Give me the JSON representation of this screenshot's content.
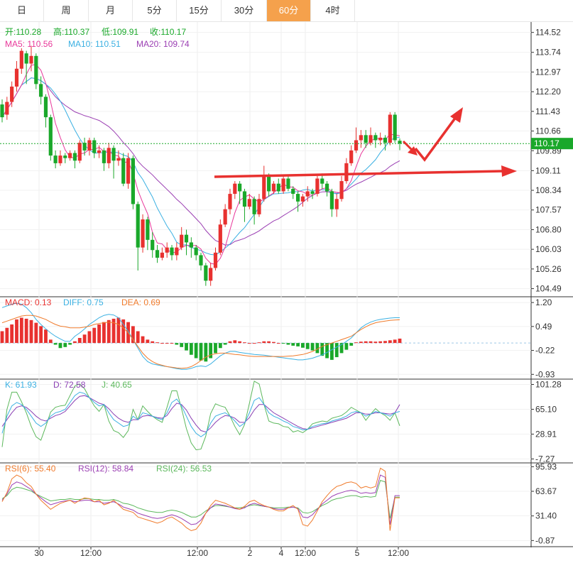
{
  "tabs": [
    {
      "label": "日",
      "active": false
    },
    {
      "label": "周",
      "active": false
    },
    {
      "label": "月",
      "active": false
    },
    {
      "label": "5分",
      "active": false
    },
    {
      "label": "15分",
      "active": false
    },
    {
      "label": "30分",
      "active": false
    },
    {
      "label": "60分",
      "active": true
    },
    {
      "label": "4时",
      "active": false
    }
  ],
  "colors": {
    "up": "#e8312f",
    "down": "#1aa82a",
    "ma5": "#e8389a",
    "ma10": "#3ab0e2",
    "ma20": "#9b3fb3",
    "macd": "#e8312f",
    "diff": "#3ab0e2",
    "dea": "#f07b2c",
    "k": "#3ab0e2",
    "d": "#8a3fb3",
    "j": "#5cb85c",
    "rsi6": "#f07b2c",
    "rsi12": "#9b3fb3",
    "rsi24": "#5cb85c",
    "active_tab": "#f5a14c",
    "price_tag": "#1aa82a",
    "arrow": "#e8312f"
  },
  "legend": {
    "ohlc": [
      {
        "label": "开:",
        "value": "110.28",
        "color": "#1aa82a"
      },
      {
        "label": "高:",
        "value": "110.37",
        "color": "#1aa82a"
      },
      {
        "label": "低:",
        "value": "109.91",
        "color": "#1aa82a"
      },
      {
        "label": "收:",
        "value": "110.17",
        "color": "#1aa82a"
      }
    ],
    "ma": [
      {
        "label": "MA5: ",
        "value": "110.56",
        "color": "#e8389a"
      },
      {
        "label": "MA10: ",
        "value": "110.51",
        "color": "#3ab0e2"
      },
      {
        "label": "MA20: ",
        "value": "109.74",
        "color": "#9b3fb3"
      }
    ],
    "macd": [
      {
        "label": "MACD: ",
        "value": "0.13",
        "color": "#e8312f"
      },
      {
        "label": "DIFF: ",
        "value": "0.75",
        "color": "#3ab0e2"
      },
      {
        "label": "DEA: ",
        "value": "0.69",
        "color": "#f07b2c"
      }
    ],
    "kdj": [
      {
        "label": "K: ",
        "value": "61.93",
        "color": "#3ab0e2"
      },
      {
        "label": "D: ",
        "value": "72.58",
        "color": "#8a3fb3"
      },
      {
        "label": "J: ",
        "value": "40.65",
        "color": "#5cb85c"
      }
    ],
    "rsi": [
      {
        "label": "RSI(6): ",
        "value": "55.40",
        "color": "#f07b2c"
      },
      {
        "label": "RSI(12): ",
        "value": "58.84",
        "color": "#9b3fb3"
      },
      {
        "label": "RSI(24): ",
        "value": "56.53",
        "color": "#5cb85c"
      }
    ]
  },
  "price_axis": {
    "ticks": [
      "114.52",
      "113.74",
      "112.97",
      "112.20",
      "111.43",
      "110.66",
      "109.89",
      "109.11",
      "108.34",
      "107.57",
      "106.80",
      "106.03",
      "105.26",
      "104.49"
    ],
    "current": "110.17"
  },
  "macd_axis": {
    "ticks": [
      "1.20",
      "0.49",
      "-0.22",
      "-0.93"
    ]
  },
  "kdj_axis": {
    "ticks": [
      "101.28",
      "65.10",
      "28.91",
      "-7.27"
    ]
  },
  "rsi_axis": {
    "ticks": [
      "95.93",
      "63.67",
      "31.40",
      "-0.87"
    ]
  },
  "time_axis": {
    "labels": [
      "30",
      "12:00",
      "12:00",
      "2",
      "4",
      "12:00",
      "5",
      "12:00"
    ]
  },
  "chart_data": {
    "type": "candlestick",
    "candles": [
      {
        "o": 111.7,
        "c": 111.2,
        "h": 111.9,
        "l": 111.0
      },
      {
        "o": 111.3,
        "c": 111.8,
        "h": 112.0,
        "l": 111.1
      },
      {
        "o": 111.8,
        "c": 112.4,
        "h": 112.6,
        "l": 111.6
      },
      {
        "o": 112.4,
        "c": 113.1,
        "h": 113.4,
        "l": 112.2
      },
      {
        "o": 113.1,
        "c": 113.8,
        "h": 113.9,
        "l": 112.9
      },
      {
        "o": 113.7,
        "c": 113.3,
        "h": 113.8,
        "l": 112.5
      },
      {
        "o": 113.3,
        "c": 113.6,
        "h": 114.0,
        "l": 113.0
      },
      {
        "o": 113.6,
        "c": 112.5,
        "h": 113.7,
        "l": 112.3
      },
      {
        "o": 112.5,
        "c": 112.0,
        "h": 112.8,
        "l": 111.7
      },
      {
        "o": 112.0,
        "c": 111.2,
        "h": 112.1,
        "l": 110.8
      },
      {
        "o": 111.2,
        "c": 109.7,
        "h": 111.3,
        "l": 109.5
      },
      {
        "o": 109.7,
        "c": 109.4,
        "h": 109.9,
        "l": 109.2
      },
      {
        "o": 109.4,
        "c": 109.7,
        "h": 109.9,
        "l": 109.3
      },
      {
        "o": 109.7,
        "c": 109.6,
        "h": 109.8,
        "l": 109.4
      },
      {
        "o": 109.6,
        "c": 109.8,
        "h": 109.9,
        "l": 109.5
      },
      {
        "o": 109.8,
        "c": 109.5,
        "h": 109.9,
        "l": 109.2
      },
      {
        "o": 109.5,
        "c": 110.2,
        "h": 110.3,
        "l": 109.4
      },
      {
        "o": 110.2,
        "c": 109.9,
        "h": 110.4,
        "l": 109.7
      },
      {
        "o": 109.9,
        "c": 110.3,
        "h": 110.4,
        "l": 109.7
      },
      {
        "o": 110.3,
        "c": 109.8,
        "h": 110.4,
        "l": 109.6
      },
      {
        "o": 109.8,
        "c": 109.9,
        "h": 110.1,
        "l": 109.6
      },
      {
        "o": 109.9,
        "c": 109.4,
        "h": 110.0,
        "l": 109.1
      },
      {
        "o": 109.4,
        "c": 110.0,
        "h": 110.2,
        "l": 109.2
      },
      {
        "o": 110.0,
        "c": 109.5,
        "h": 110.1,
        "l": 108.8
      },
      {
        "o": 109.5,
        "c": 109.6,
        "h": 109.9,
        "l": 109.3
      },
      {
        "o": 109.6,
        "c": 108.6,
        "h": 109.8,
        "l": 108.5
      },
      {
        "o": 108.6,
        "c": 109.6,
        "h": 109.8,
        "l": 108.4
      },
      {
        "o": 109.6,
        "c": 107.8,
        "h": 109.7,
        "l": 107.6
      },
      {
        "o": 107.8,
        "c": 106.1,
        "h": 107.9,
        "l": 105.2
      },
      {
        "o": 106.1,
        "c": 107.2,
        "h": 107.4,
        "l": 105.9
      },
      {
        "o": 107.2,
        "c": 106.4,
        "h": 107.3,
        "l": 106.0
      },
      {
        "o": 106.4,
        "c": 106.0,
        "h": 106.7,
        "l": 105.7
      },
      {
        "o": 106.0,
        "c": 105.7,
        "h": 106.2,
        "l": 105.5
      },
      {
        "o": 105.7,
        "c": 105.9,
        "h": 106.1,
        "l": 105.6
      },
      {
        "o": 105.9,
        "c": 106.1,
        "h": 106.3,
        "l": 105.7
      },
      {
        "o": 106.1,
        "c": 105.8,
        "h": 106.2,
        "l": 105.6
      },
      {
        "o": 105.8,
        "c": 106.1,
        "h": 106.3,
        "l": 105.6
      },
      {
        "o": 106.1,
        "c": 106.6,
        "h": 106.9,
        "l": 106.0
      },
      {
        "o": 106.6,
        "c": 106.3,
        "h": 106.8,
        "l": 105.8
      },
      {
        "o": 106.3,
        "c": 106.1,
        "h": 106.5,
        "l": 105.7
      },
      {
        "o": 106.1,
        "c": 105.8,
        "h": 106.2,
        "l": 105.6
      },
      {
        "o": 105.8,
        "c": 105.4,
        "h": 105.9,
        "l": 105.2
      },
      {
        "o": 105.4,
        "c": 104.8,
        "h": 105.5,
        "l": 104.6
      },
      {
        "o": 104.8,
        "c": 105.3,
        "h": 105.5,
        "l": 104.6
      },
      {
        "o": 105.3,
        "c": 105.9,
        "h": 106.1,
        "l": 105.2
      },
      {
        "o": 105.9,
        "c": 107.0,
        "h": 107.2,
        "l": 105.8
      },
      {
        "o": 107.0,
        "c": 107.6,
        "h": 107.8,
        "l": 106.9
      },
      {
        "o": 107.6,
        "c": 108.2,
        "h": 108.4,
        "l": 107.4
      },
      {
        "o": 108.2,
        "c": 108.6,
        "h": 108.7,
        "l": 108.0
      },
      {
        "o": 108.6,
        "c": 108.3,
        "h": 108.7,
        "l": 107.8
      },
      {
        "o": 108.3,
        "c": 107.7,
        "h": 108.4,
        "l": 107.1
      },
      {
        "o": 107.7,
        "c": 108.0,
        "h": 108.2,
        "l": 107.6
      },
      {
        "o": 108.0,
        "c": 107.4,
        "h": 108.1,
        "l": 107.0
      },
      {
        "o": 107.4,
        "c": 108.0,
        "h": 108.2,
        "l": 107.3
      },
      {
        "o": 108.0,
        "c": 108.9,
        "h": 109.3,
        "l": 107.9
      },
      {
        "o": 108.9,
        "c": 108.3,
        "h": 109.0,
        "l": 108.1
      },
      {
        "o": 108.3,
        "c": 108.6,
        "h": 108.7,
        "l": 108.2
      },
      {
        "o": 108.6,
        "c": 108.3,
        "h": 108.8,
        "l": 108.2
      },
      {
        "o": 108.3,
        "c": 108.8,
        "h": 108.9,
        "l": 108.2
      },
      {
        "o": 108.8,
        "c": 108.4,
        "h": 108.9,
        "l": 108.3
      },
      {
        "o": 108.4,
        "c": 108.2,
        "h": 108.5,
        "l": 108.0
      },
      {
        "o": 108.2,
        "c": 107.9,
        "h": 108.3,
        "l": 107.5
      },
      {
        "o": 107.9,
        "c": 108.1,
        "h": 108.2,
        "l": 107.7
      },
      {
        "o": 108.1,
        "c": 108.3,
        "h": 108.5,
        "l": 107.9
      },
      {
        "o": 108.3,
        "c": 108.2,
        "h": 108.4,
        "l": 108.0
      },
      {
        "o": 108.2,
        "c": 108.8,
        "h": 108.9,
        "l": 108.1
      },
      {
        "o": 108.8,
        "c": 108.6,
        "h": 109.0,
        "l": 108.4
      },
      {
        "o": 108.6,
        "c": 108.3,
        "h": 108.7,
        "l": 108.1
      },
      {
        "o": 108.3,
        "c": 107.6,
        "h": 108.4,
        "l": 107.3
      },
      {
        "o": 107.6,
        "c": 108.0,
        "h": 108.2,
        "l": 107.3
      },
      {
        "o": 108.0,
        "c": 108.7,
        "h": 108.9,
        "l": 107.9
      },
      {
        "o": 108.7,
        "c": 109.4,
        "h": 109.6,
        "l": 108.6
      },
      {
        "o": 109.4,
        "c": 109.9,
        "h": 110.1,
        "l": 109.3
      },
      {
        "o": 109.9,
        "c": 110.3,
        "h": 110.8,
        "l": 109.8
      },
      {
        "o": 110.3,
        "c": 110.5,
        "h": 110.7,
        "l": 110.0
      },
      {
        "o": 110.5,
        "c": 110.2,
        "h": 110.7,
        "l": 110.0
      },
      {
        "o": 110.2,
        "c": 110.5,
        "h": 110.8,
        "l": 110.1
      },
      {
        "o": 110.5,
        "c": 110.3,
        "h": 110.6,
        "l": 110.0
      },
      {
        "o": 110.3,
        "c": 110.4,
        "h": 110.6,
        "l": 110.1
      },
      {
        "o": 110.4,
        "c": 110.2,
        "h": 110.5,
        "l": 109.9
      },
      {
        "o": 110.2,
        "c": 111.3,
        "h": 111.4,
        "l": 110.1
      },
      {
        "o": 111.3,
        "c": 110.3,
        "h": 111.4,
        "l": 110.2
      },
      {
        "o": 110.28,
        "c": 110.17,
        "h": 110.37,
        "l": 109.91
      }
    ],
    "macd_hist": [
      0.35,
      0.45,
      0.55,
      0.7,
      0.75,
      0.72,
      0.68,
      0.6,
      0.5,
      0.4,
      0.1,
      -0.05,
      -0.15,
      -0.12,
      -0.05,
      0.05,
      0.15,
      0.25,
      0.35,
      0.45,
      0.55,
      0.62,
      0.68,
      0.72,
      0.75,
      0.7,
      0.62,
      0.5,
      0.35,
      0.2,
      0.1,
      0.05,
      0.02,
      0.0,
      0.0,
      0.0,
      -0.05,
      -0.12,
      -0.22,
      -0.35,
      -0.45,
      -0.52,
      -0.55,
      -0.45,
      -0.3,
      -0.15,
      -0.05,
      0.05,
      0.08,
      0.05,
      0.02,
      0.0,
      0.0,
      0.02,
      0.05,
      0.05,
      0.03,
      0.0,
      -0.02,
      -0.05,
      -0.08,
      -0.1,
      -0.14,
      -0.18,
      -0.22,
      -0.3,
      -0.38,
      -0.45,
      -0.5,
      -0.42,
      -0.3,
      -0.2,
      -0.08,
      0.02,
      0.04,
      0.05,
      0.05,
      0.04,
      0.05,
      0.06,
      0.08,
      0.1,
      0.13
    ],
    "diff": [
      1.05,
      1.1,
      1.15,
      1.18,
      1.15,
      1.05,
      0.9,
      0.7,
      0.55,
      0.42,
      0.3,
      0.2,
      0.12,
      0.05,
      0.05,
      0.2,
      0.3,
      0.42,
      0.55,
      0.65,
      0.75,
      0.82,
      0.85,
      0.83,
      0.75,
      0.55,
      0.35,
      0.1,
      -0.15,
      -0.4,
      -0.55,
      -0.62,
      -0.65,
      -0.68,
      -0.7,
      -0.73,
      -0.76,
      -0.78,
      -0.78,
      -0.75,
      -0.7,
      -0.68,
      -0.7,
      -0.62,
      -0.5,
      -0.38,
      -0.3,
      -0.25,
      -0.25,
      -0.28,
      -0.3,
      -0.32,
      -0.34,
      -0.35,
      -0.36,
      -0.38,
      -0.4,
      -0.42,
      -0.44,
      -0.46,
      -0.48,
      -0.5,
      -0.5,
      -0.48,
      -0.45,
      -0.4,
      -0.35,
      -0.28,
      -0.2,
      -0.12,
      -0.05,
      0.05,
      0.15,
      0.3,
      0.45,
      0.55,
      0.62,
      0.67,
      0.7,
      0.72,
      0.74,
      0.75,
      0.75
    ],
    "dea": [
      0.6,
      0.65,
      0.7,
      0.75,
      0.8,
      0.82,
      0.82,
      0.8,
      0.75,
      0.7,
      0.62,
      0.55,
      0.5,
      0.48,
      0.45,
      0.45,
      0.45,
      0.47,
      0.5,
      0.55,
      0.58,
      0.6,
      0.62,
      0.6,
      0.55,
      0.45,
      0.3,
      0.1,
      -0.1,
      -0.3,
      -0.45,
      -0.55,
      -0.62,
      -0.66,
      -0.7,
      -0.72,
      -0.74,
      -0.75,
      -0.74,
      -0.7,
      -0.62,
      -0.52,
      -0.42,
      -0.35,
      -0.32,
      -0.3,
      -0.3,
      -0.32,
      -0.34,
      -0.35,
      -0.37,
      -0.39,
      -0.4,
      -0.4,
      -0.4,
      -0.4,
      -0.4,
      -0.4,
      -0.4,
      -0.39,
      -0.38,
      -0.36,
      -0.34,
      -0.3,
      -0.25,
      -0.18,
      -0.1,
      -0.05,
      0.0,
      0.05,
      0.1,
      0.15,
      0.2,
      0.3,
      0.4,
      0.48,
      0.55,
      0.6,
      0.63,
      0.65,
      0.67,
      0.68,
      0.69
    ],
    "k": [
      30,
      55,
      70,
      75,
      72,
      65,
      55,
      45,
      40,
      45,
      55,
      60,
      62,
      65,
      75,
      85,
      90,
      88,
      82,
      75,
      70,
      72,
      60,
      50,
      45,
      40,
      42,
      55,
      50,
      60,
      58,
      55,
      52,
      50,
      60,
      75,
      80,
      70,
      55,
      40,
      30,
      25,
      30,
      45,
      55,
      58,
      60,
      55,
      48,
      40,
      45,
      60,
      78,
      82,
      72,
      60,
      55,
      52,
      48,
      45,
      40,
      38,
      35,
      36,
      40,
      42,
      44,
      45,
      48,
      50,
      52,
      55,
      60,
      62,
      60,
      55,
      58,
      62,
      60,
      58,
      55,
      60,
      62
    ],
    "d": [
      40,
      50,
      60,
      68,
      70,
      68,
      62,
      55,
      50,
      48,
      52,
      56,
      58,
      62,
      70,
      78,
      84,
      85,
      82,
      78,
      74,
      72,
      66,
      58,
      52,
      48,
      46,
      50,
      50,
      55,
      56,
      55,
      53,
      52,
      56,
      66,
      74,
      72,
      64,
      52,
      42,
      34,
      32,
      38,
      46,
      52,
      56,
      55,
      52,
      46,
      46,
      53,
      64,
      72,
      72,
      66,
      60,
      56,
      52,
      48,
      44,
      40,
      37,
      36,
      38,
      40,
      42,
      44,
      46,
      48,
      50,
      52,
      56,
      60,
      60,
      58,
      58,
      60,
      60,
      59,
      58,
      60,
      72
    ],
    "j": [
      10,
      65,
      90,
      90,
      76,
      60,
      40,
      25,
      20,
      40,
      61,
      68,
      70,
      71,
      85,
      99,
      102,
      95,
      82,
      70,
      62,
      72,
      48,
      34,
      31,
      24,
      34,
      65,
      50,
      70,
      62,
      55,
      50,
      46,
      68,
      92,
      92,
      66,
      37,
      16,
      6,
      7,
      26,
      59,
      73,
      70,
      68,
      55,
      40,
      28,
      43,
      74,
      106,
      102,
      72,
      48,
      45,
      44,
      40,
      39,
      32,
      34,
      31,
      36,
      44,
      46,
      48,
      47,
      52,
      54,
      56,
      61,
      68,
      64,
      60,
      49,
      58,
      66,
      60,
      56,
      49,
      60,
      41
    ],
    "rsi6": [
      50,
      62,
      80,
      85,
      82,
      75,
      70,
      60,
      52,
      46,
      40,
      44,
      48,
      50,
      52,
      48,
      52,
      55,
      54,
      50,
      52,
      46,
      48,
      52,
      46,
      40,
      38,
      36,
      30,
      28,
      26,
      24,
      22,
      24,
      28,
      30,
      26,
      22,
      16,
      12,
      14,
      22,
      35,
      45,
      52,
      50,
      48,
      45,
      42,
      40,
      44,
      50,
      52,
      48,
      45,
      43,
      40,
      38,
      38,
      42,
      45,
      40,
      20,
      18,
      26,
      38,
      50,
      58,
      65,
      70,
      72,
      75,
      76,
      74,
      68,
      70,
      68,
      70,
      94,
      90,
      12,
      55,
      55
    ],
    "rsi12": [
      52,
      60,
      72,
      76,
      74,
      70,
      66,
      60,
      55,
      50,
      46,
      48,
      50,
      51,
      52,
      50,
      51,
      52,
      52,
      50,
      50,
      48,
      49,
      50,
      47,
      43,
      41,
      39,
      35,
      33,
      31,
      29,
      28,
      29,
      31,
      33,
      31,
      28,
      24,
      20,
      21,
      26,
      35,
      42,
      47,
      46,
      45,
      43,
      41,
      40,
      42,
      46,
      48,
      46,
      44,
      43,
      41,
      40,
      40,
      42,
      43,
      41,
      30,
      29,
      33,
      40,
      47,
      52,
      57,
      60,
      62,
      64,
      65,
      64,
      61,
      62,
      61,
      62,
      85,
      82,
      20,
      58,
      58
    ],
    "rsi24": [
      54,
      58,
      66,
      69,
      68,
      66,
      64,
      60,
      57,
      54,
      51,
      52,
      53,
      53,
      54,
      53,
      53,
      54,
      54,
      53,
      53,
      52,
      52,
      53,
      51,
      48,
      47,
      45,
      42,
      40,
      38,
      37,
      36,
      36,
      38,
      39,
      38,
      36,
      33,
      30,
      30,
      33,
      38,
      42,
      45,
      45,
      44,
      43,
      42,
      42,
      43,
      45,
      46,
      45,
      44,
      43,
      42,
      42,
      42,
      43,
      43,
      42,
      36,
      35,
      37,
      41,
      45,
      48,
      52,
      54,
      55,
      57,
      58,
      58,
      56,
      57,
      56,
      57,
      78,
      76,
      28,
      56,
      56
    ]
  }
}
